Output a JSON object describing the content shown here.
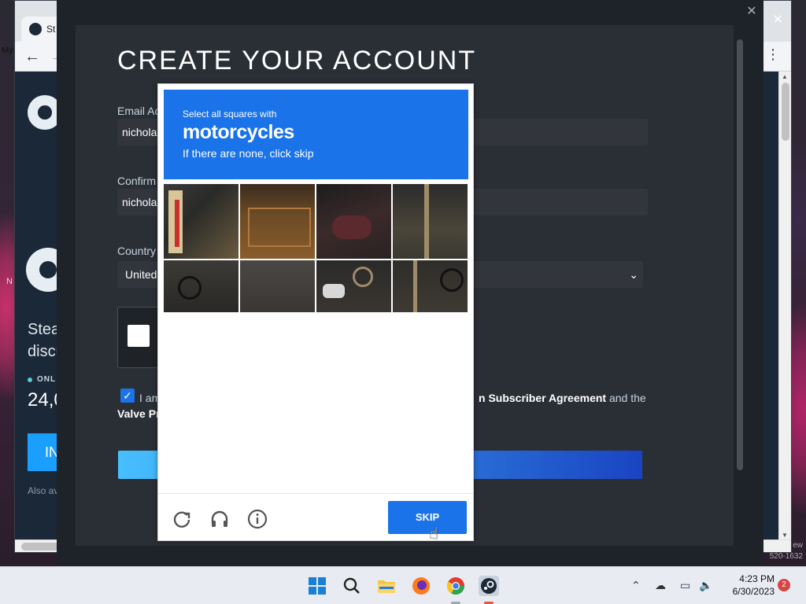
{
  "browser": {
    "tab_title": "St",
    "side_label_top": "My",
    "side_label_mid": "N",
    "right_label_1": "ew",
    "right_label_2": "520-1632"
  },
  "store": {
    "headline_line1": "Stea",
    "headline_line2": "discu",
    "online_label": "ONL",
    "online_count": "24,0",
    "install_label": "IN",
    "also_label": "Also av"
  },
  "dialog": {
    "title": "CREATE YOUR ACCOUNT",
    "email_label": "Email Ac",
    "email_value": "nichola",
    "confirm_label": "Confirm",
    "confirm_value": "nichola",
    "country_label": "Country",
    "country_value": "United",
    "agree_a": "I am",
    "agree_b_plain": "and the",
    "agree_b_bold": "n Subscriber Agreement",
    "agree_c": "Valve Pr"
  },
  "challenge": {
    "line1": "Select all squares with",
    "subject": "motorcycles",
    "line3": "If there are none, click skip",
    "skip_label": "SKIP",
    "icons": [
      "refresh-icon",
      "headphones-icon",
      "info-icon"
    ]
  },
  "taskbar": {
    "time": "4:23 PM",
    "date": "6/30/2023",
    "notification_count": "2"
  },
  "colors": {
    "prompt_blue": "#1a73e8",
    "steam_dark": "#1b2838",
    "dialog_bg": "#2a2f36"
  }
}
